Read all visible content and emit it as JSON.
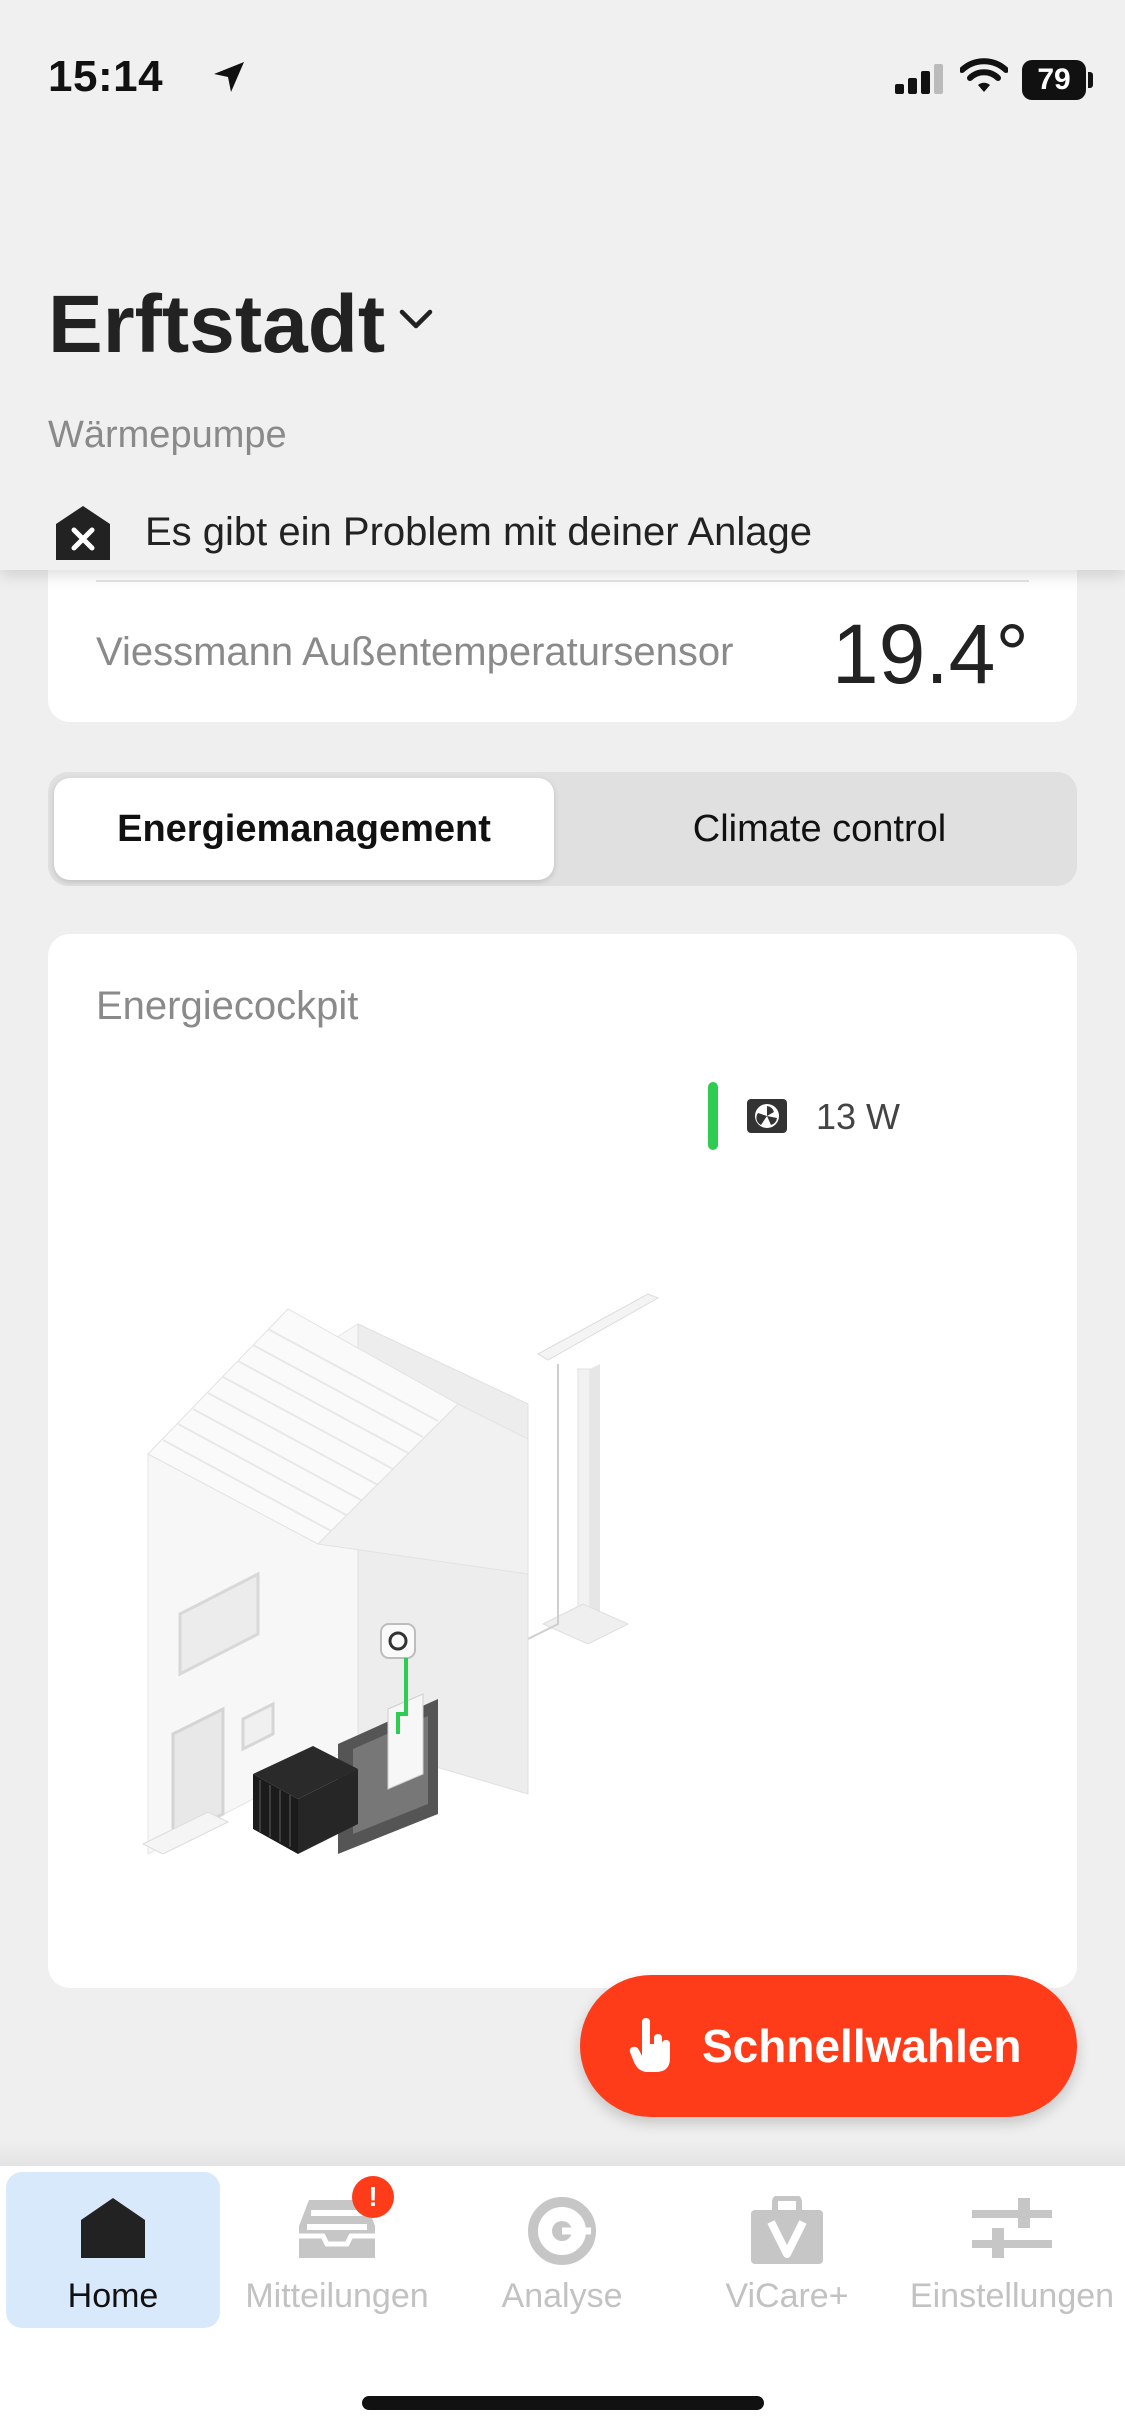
{
  "status_bar": {
    "time": "15:14",
    "battery": "79"
  },
  "header": {
    "location": "Erftstadt",
    "device": "Wärmepumpe",
    "alert": "Es gibt ein Problem mit deiner Anlage"
  },
  "temperature": {
    "label": "Viessmann Außentemperatursensor",
    "value": "19.4°"
  },
  "tabs": [
    {
      "label": "Energiemanagement",
      "selected": true
    },
    {
      "label": "Climate control",
      "selected": false
    }
  ],
  "cockpit": {
    "title": "Energiecockpit",
    "power": "13 W",
    "power_color": "#2ecc51"
  },
  "fab": {
    "label": "Schnellwahlen",
    "color": "#ff3c1a"
  },
  "nav": {
    "items": [
      {
        "label": "Home",
        "icon": "house-icon",
        "active": true
      },
      {
        "label": "Mitteilungen",
        "icon": "inbox-icon",
        "badge": "!"
      },
      {
        "label": "Analyse",
        "icon": "analysis-icon"
      },
      {
        "label": "ViCare+",
        "icon": "toolbag-icon"
      },
      {
        "label": "Einstellungen",
        "icon": "sliders-icon"
      }
    ]
  }
}
